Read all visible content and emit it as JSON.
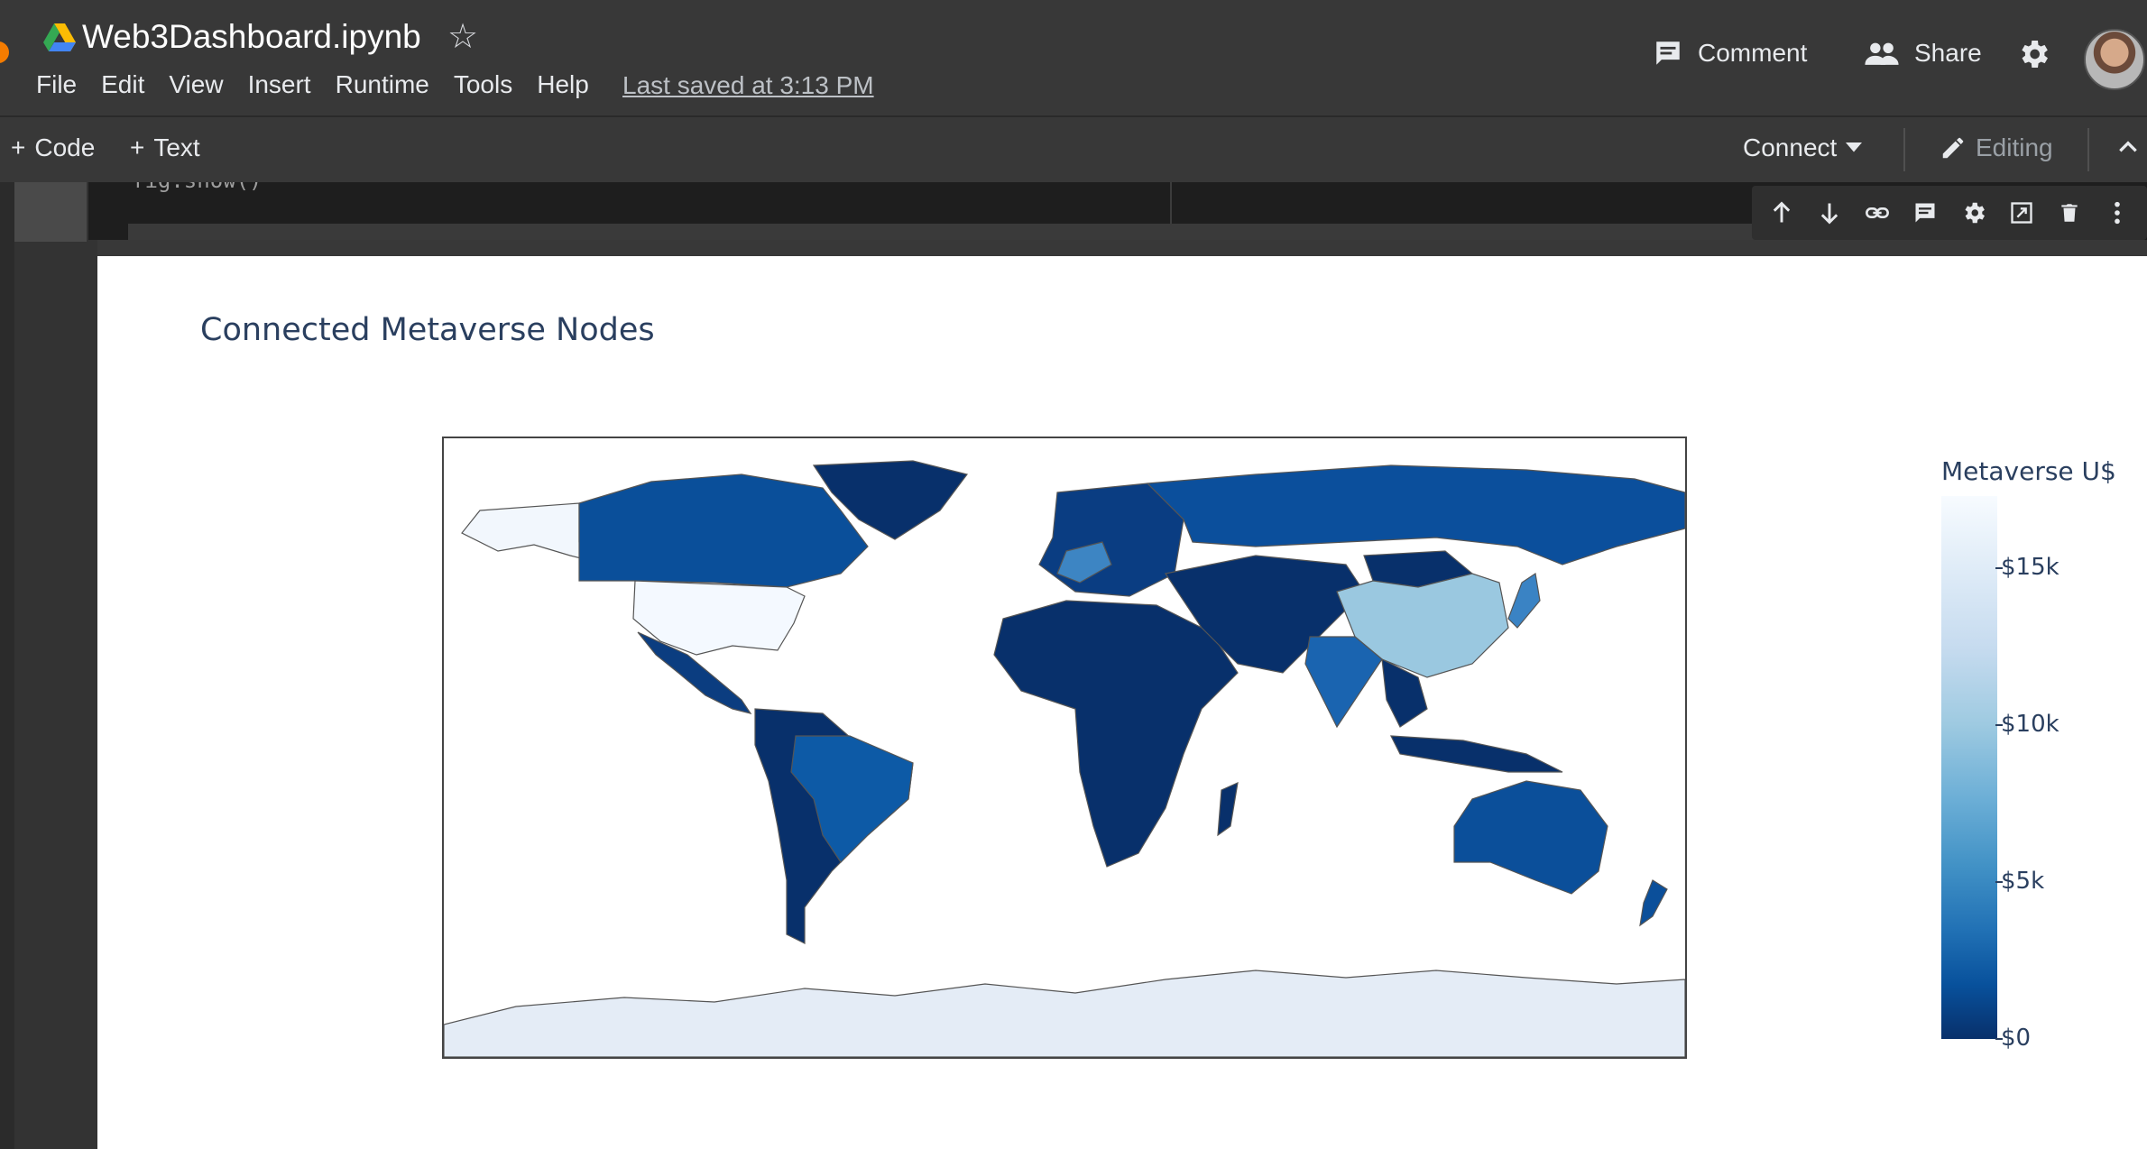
{
  "header": {
    "title": "Web3Dashboard.ipynb",
    "menu": [
      "File",
      "Edit",
      "View",
      "Insert",
      "Runtime",
      "Tools",
      "Help"
    ],
    "last_saved": "Last saved at 3:13 PM",
    "comment_label": "Comment",
    "share_label": "Share"
  },
  "toolbar": {
    "add_code_label": "Code",
    "add_text_label": "Text",
    "connect_label": "Connect",
    "editing_label": "Editing"
  },
  "code_cell": {
    "visible_code": "fig.show()"
  },
  "cell_toolbar_icons": [
    "move-up-icon",
    "move-down-icon",
    "link-icon",
    "comment-icon",
    "settings-icon",
    "mirror-cell-icon",
    "delete-icon",
    "more-icon"
  ],
  "output": {
    "chart_title": "Connected Metaverse Nodes",
    "colorbar_title": "Metaverse U$",
    "colorbar_ticks": [
      "$15k",
      "$10k",
      "$5k",
      "$0"
    ],
    "colorbar_range": [
      0,
      16500
    ],
    "colorscale": [
      "#08306b",
      "#08519c",
      "#2171b5",
      "#4292c6",
      "#6baed6",
      "#9ecae1",
      "#c6dbef",
      "#deebf7",
      "#f7fbff"
    ]
  },
  "chart_data": {
    "type": "choropleth",
    "title": "Connected Metaverse Nodes",
    "colorbar_title": "Metaverse U$",
    "zrange": [
      0,
      16500
    ],
    "regions": [
      {
        "name": "United States",
        "value": 16000
      },
      {
        "name": "Alaska",
        "value": 16000
      },
      {
        "name": "China",
        "value": 9500
      },
      {
        "name": "Antarctica",
        "value": 14000
      },
      {
        "name": "Canada",
        "value": 2000
      },
      {
        "name": "Russia",
        "value": 3000
      },
      {
        "name": "Brazil",
        "value": 3500
      },
      {
        "name": "Australia",
        "value": 2500
      },
      {
        "name": "India",
        "value": 2500
      },
      {
        "name": "Japan",
        "value": 4500
      },
      {
        "name": "Greenland",
        "value": 500
      },
      {
        "name": "Africa",
        "value": 300
      }
    ]
  }
}
